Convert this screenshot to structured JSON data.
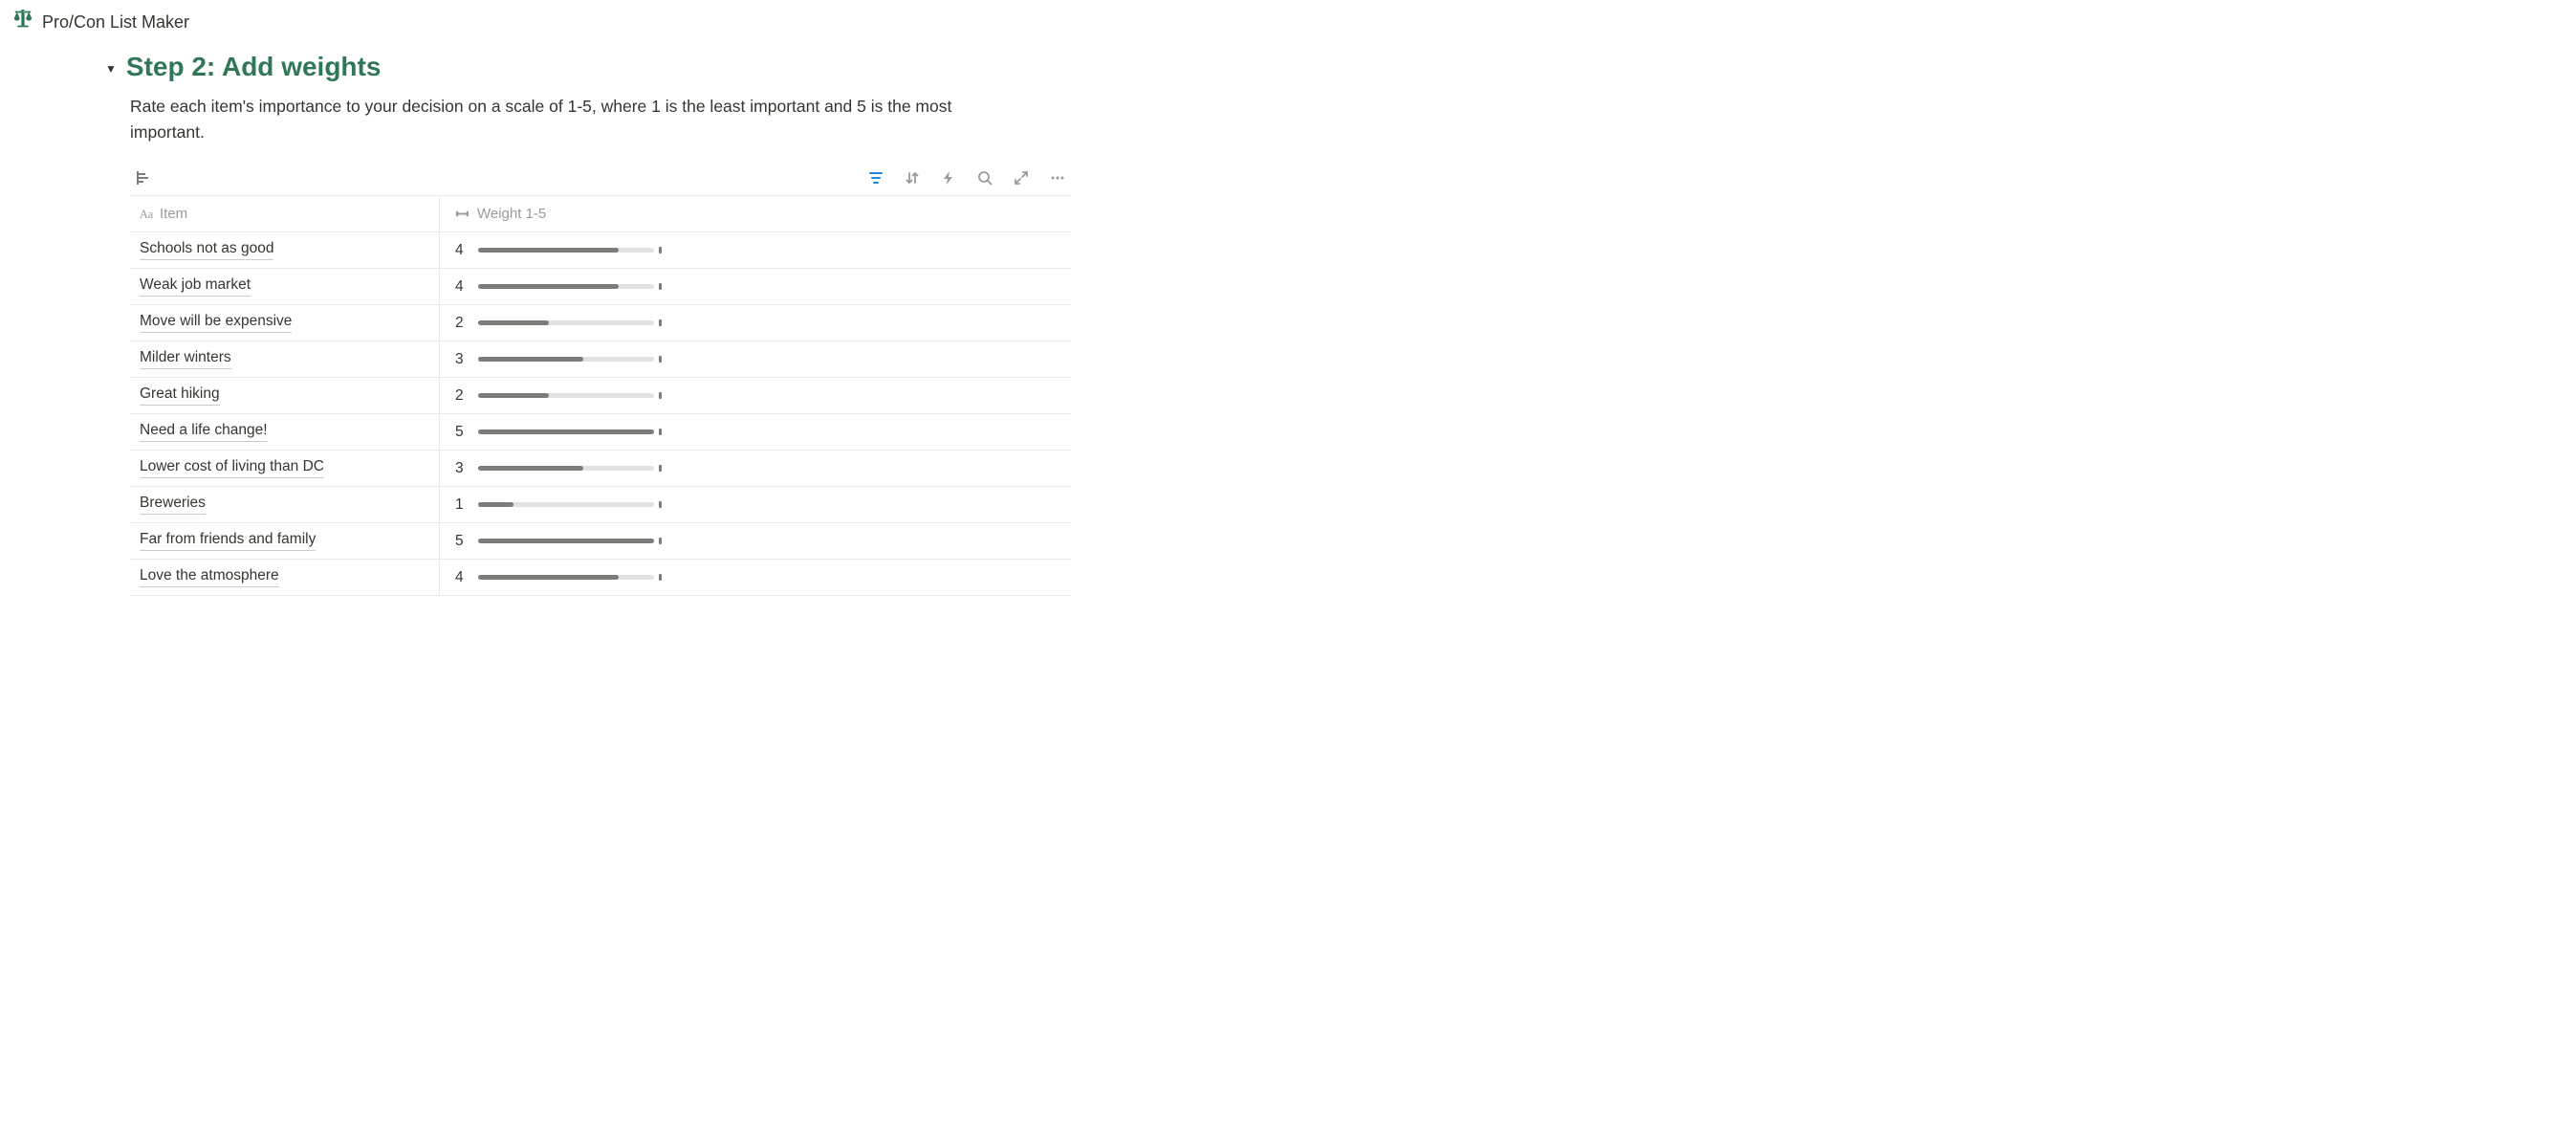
{
  "topbar": {
    "title": "Pro/Con List Maker"
  },
  "section": {
    "heading": "Step 2: Add weights",
    "description": "Rate each item's importance to your decision on a scale of 1-5, where 1 is the least important and 5 is the most important."
  },
  "table": {
    "columns": {
      "item": "Item",
      "weight": "Weight 1-5"
    },
    "rows": [
      {
        "item": "Schools not as good",
        "weight": 4
      },
      {
        "item": "Weak job market",
        "weight": 4
      },
      {
        "item": "Move will be expensive",
        "weight": 2
      },
      {
        "item": "Milder winters",
        "weight": 3
      },
      {
        "item": "Great hiking",
        "weight": 2
      },
      {
        "item": "Need a life change!",
        "weight": 5
      },
      {
        "item": "Lower cost of living than DC",
        "weight": 3
      },
      {
        "item": "Breweries",
        "weight": 1
      },
      {
        "item": "Far from friends and family",
        "weight": 5
      },
      {
        "item": "Love the atmosphere",
        "weight": 4
      }
    ]
  }
}
